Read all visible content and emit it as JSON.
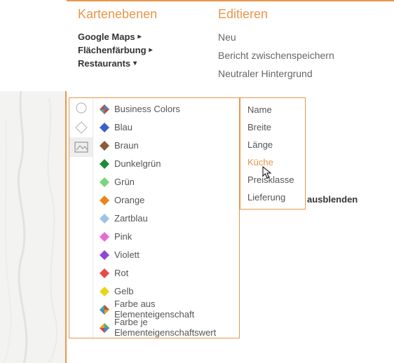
{
  "sections": {
    "layers_title": "Kartenebenen",
    "edit_title": "Editieren"
  },
  "nav": {
    "items": [
      {
        "label": "Google Maps",
        "marker": "▸"
      },
      {
        "label": "Flächenfärbung",
        "marker": "▸"
      },
      {
        "label": "Restaurants",
        "marker": "▾"
      }
    ]
  },
  "edit_menu": {
    "items": [
      {
        "label": "Neu"
      },
      {
        "label": "Bericht zwischenspeichern"
      },
      {
        "label": "Neutraler Hintergrund"
      }
    ]
  },
  "truncated": {
    "ausblenden": "ausblenden"
  },
  "color_flyout": {
    "items": [
      {
        "label": "Business Colors",
        "color": "multi1"
      },
      {
        "label": "Blau",
        "color": "#3a63c8"
      },
      {
        "label": "Braun",
        "color": "#8a5a3a"
      },
      {
        "label": "Dunkelgrün",
        "color": "#1f8a3a"
      },
      {
        "label": "Grün",
        "color": "#7ad47a"
      },
      {
        "label": "Orange",
        "color": "#e8861a"
      },
      {
        "label": "Zartblau",
        "color": "#9cc3e8"
      },
      {
        "label": "Pink",
        "color": "#e86ad4"
      },
      {
        "label": "Violett",
        "color": "#8a4ad4"
      },
      {
        "label": "Rot",
        "color": "#e84a4a"
      },
      {
        "label": "Gelb",
        "color": "#e8d41a"
      },
      {
        "label": "Farbe aus Elementeigenschaft",
        "color": "multi2"
      },
      {
        "label": "Farbe je Elementeigenschaftswert",
        "color": "multi3"
      }
    ]
  },
  "attr_flyout": {
    "items": [
      {
        "label": "Name"
      },
      {
        "label": "Breite"
      },
      {
        "label": "Länge"
      },
      {
        "label": "Küche",
        "hover": true
      },
      {
        "label": "Preisklasse"
      },
      {
        "label": "Lieferung"
      }
    ]
  }
}
